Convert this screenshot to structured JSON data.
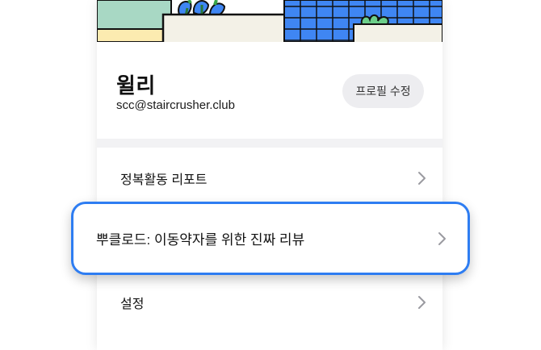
{
  "profile": {
    "name": "윌리",
    "email": "scc@staircrusher.club",
    "edit_label": "프로필 수정"
  },
  "menu": {
    "items": [
      {
        "label": "정복활동 리포트"
      },
      {
        "label": "뿌클로드: 이동약자를 위한 진짜 리뷰"
      },
      {
        "label": "설정"
      }
    ]
  },
  "colors": {
    "highlight_border": "#2e7df2",
    "banner_building_blue": "#3f86f3",
    "banner_sky_green": "#a8d8c4",
    "banner_ground_yellow": "#fcebb0",
    "divider": "#f2f2f4"
  }
}
